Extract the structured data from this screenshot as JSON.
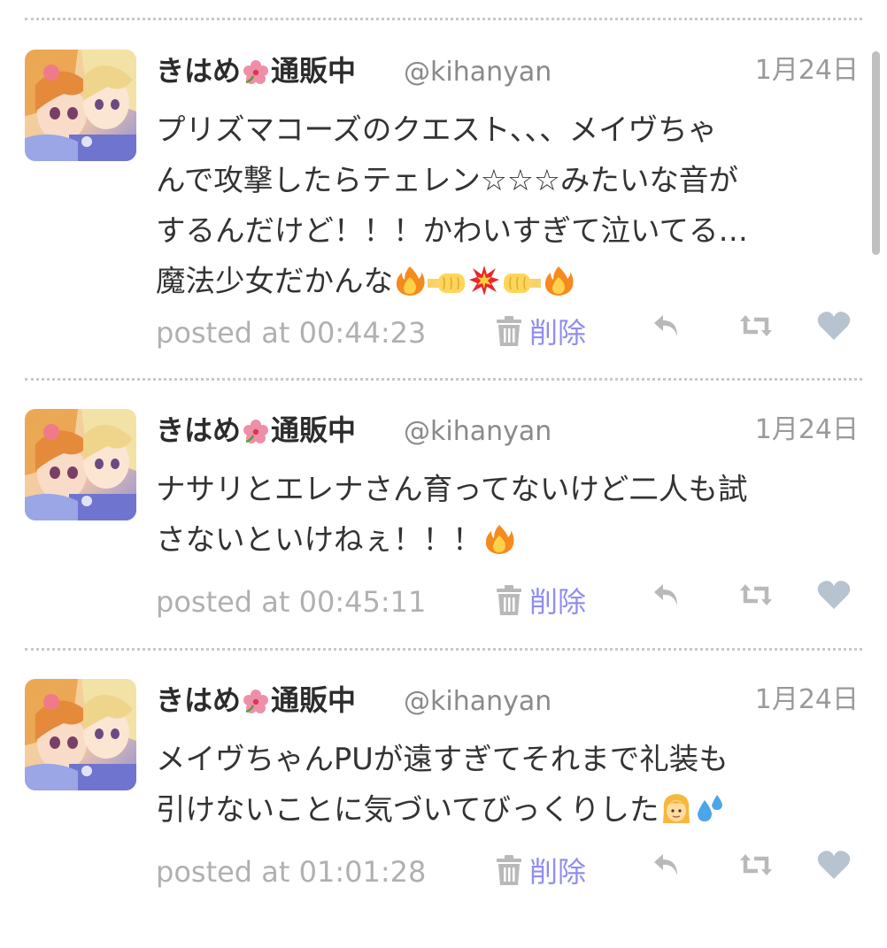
{
  "tweets": [
    {
      "display_name": "きはめ",
      "display_name_suffix": "通販中",
      "handle": "@kihanyan",
      "date": "1月24日",
      "lines": [
        "プリズマコーズのクエスト、、、メイヴちゃ",
        "んで攻撃したらテェレン☆☆☆みたいな音が",
        "するんだけど！！！かわいすぎて泣いてる…",
        "魔法少女だかんな"
      ],
      "line_emojis": [
        [],
        [],
        [],
        [
          "fire",
          "left-fist",
          "collision",
          "right-fist",
          "fire"
        ]
      ],
      "posted": "posted at 00:44:23",
      "delete_label": "削除"
    },
    {
      "display_name": "きはめ",
      "display_name_suffix": "通販中",
      "handle": "@kihanyan",
      "date": "1月24日",
      "lines": [
        "ナサリとエレナさん育ってないけど二人も試",
        "さないといけねぇ！！！"
      ],
      "line_emojis": [
        [],
        [
          "fire"
        ]
      ],
      "posted": "posted at 00:45:11",
      "delete_label": "削除"
    },
    {
      "display_name": "きはめ",
      "display_name_suffix": "通販中",
      "handle": "@kihanyan",
      "date": "1月24日",
      "lines": [
        "メイヴちゃんPUが遠すぎてそれまで礼装も",
        "引けないことに気づいてびっくりした"
      ],
      "line_emojis": [
        [],
        [
          "person-blond",
          "sweat-droplets"
        ]
      ],
      "posted": "posted at 01:01:28",
      "delete_label": "削除"
    }
  ],
  "icons": {
    "name_emoji": "hibiscus-icon",
    "delete": "trash-icon",
    "reply": "reply-icon",
    "retweet": "retweet-icon",
    "favorite": "heart-icon"
  },
  "colors": {
    "delete_link": "#8f8ef0",
    "icon_gray": "#b9b9b9",
    "heart": "#b7c4cf",
    "divider": "#c8c8c8"
  }
}
